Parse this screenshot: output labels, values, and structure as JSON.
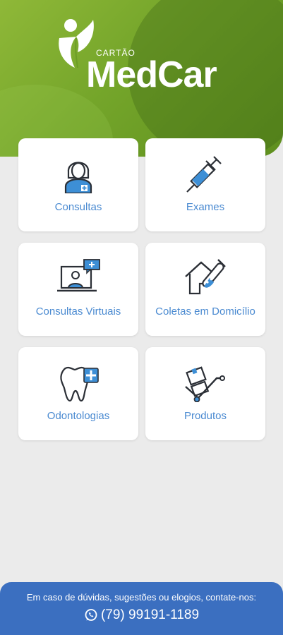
{
  "header": {
    "brand_small": "CARTÃO",
    "brand_name": "MedCar"
  },
  "menu": [
    {
      "label": "Consultas",
      "icon": "doctor-icon"
    },
    {
      "label": "Exames",
      "icon": "syringe-icon"
    },
    {
      "label": "Consultas Virtuais",
      "icon": "video-consult-icon"
    },
    {
      "label": "Coletas em Domicílio",
      "icon": "home-test-tube-icon"
    },
    {
      "label": "Odontologias",
      "icon": "tooth-icon"
    },
    {
      "label": "Produtos",
      "icon": "hand-truck-icon"
    }
  ],
  "footer": {
    "message": "Em caso de dúvidas, sugestões ou elogios, contate-nos:",
    "phone": "(79) 99191-1189",
    "icon": "whatsapp-icon"
  },
  "colors": {
    "green": "#74a52a",
    "accent_blue": "#4a8ad1",
    "icon_blue": "#3d8fd6",
    "footer_blue": "#3b6fc0"
  }
}
